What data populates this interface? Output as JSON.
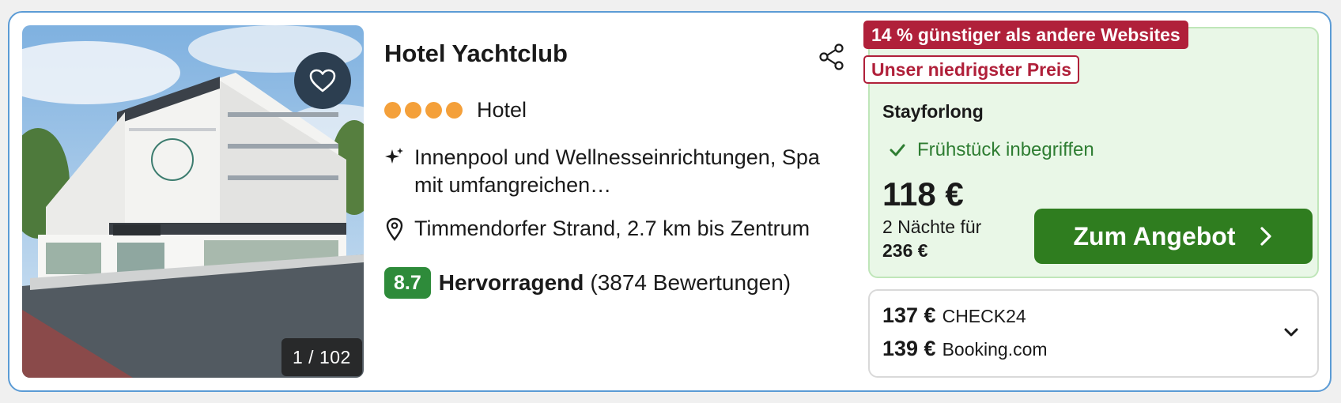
{
  "hotel": {
    "name": "Hotel Yachtclub",
    "category": "Hotel",
    "stars": 4,
    "feature": "Innenpool und Wellnesseinrichtungen, Spa mit umfangreichen…",
    "location": "Timmendorfer Strand, 2.7 km bis Zentrum",
    "rating": {
      "score": "8.7",
      "label": "Hervorragend",
      "count": "(3874 Bewertungen)"
    },
    "photo_counter": "1 / 102"
  },
  "offer": {
    "discount_badge": "14 % günstiger als andere Websites",
    "lowest_price_badge": "Unser niedrigster Preis",
    "provider": "Stayforlong",
    "breakfast": "Frühstück inbegriffen",
    "price": "118 €",
    "nights_text": "2 Nächte für",
    "total": "236 €",
    "cta_label": "Zum Angebot"
  },
  "alternatives": [
    {
      "price": "137 €",
      "provider": "CHECK24"
    },
    {
      "price": "139 €",
      "provider": "Booking.com"
    }
  ],
  "colors": {
    "card_border": "#5b9bd5",
    "star_dot": "#f4a03a",
    "score_badge": "#2e8b3a",
    "discount_badge": "#b0203a",
    "offer_bg": "#e9f7e7",
    "cta": "#2f7d1f",
    "breakfast_text": "#2e7d32"
  },
  "icons": {
    "favorite": "heart-icon",
    "share": "share-icon",
    "feature": "sparkle-icon",
    "location": "map-pin-icon",
    "breakfast": "checkmark-icon",
    "cta": "chevron-right-icon",
    "expand": "chevron-down-icon"
  }
}
